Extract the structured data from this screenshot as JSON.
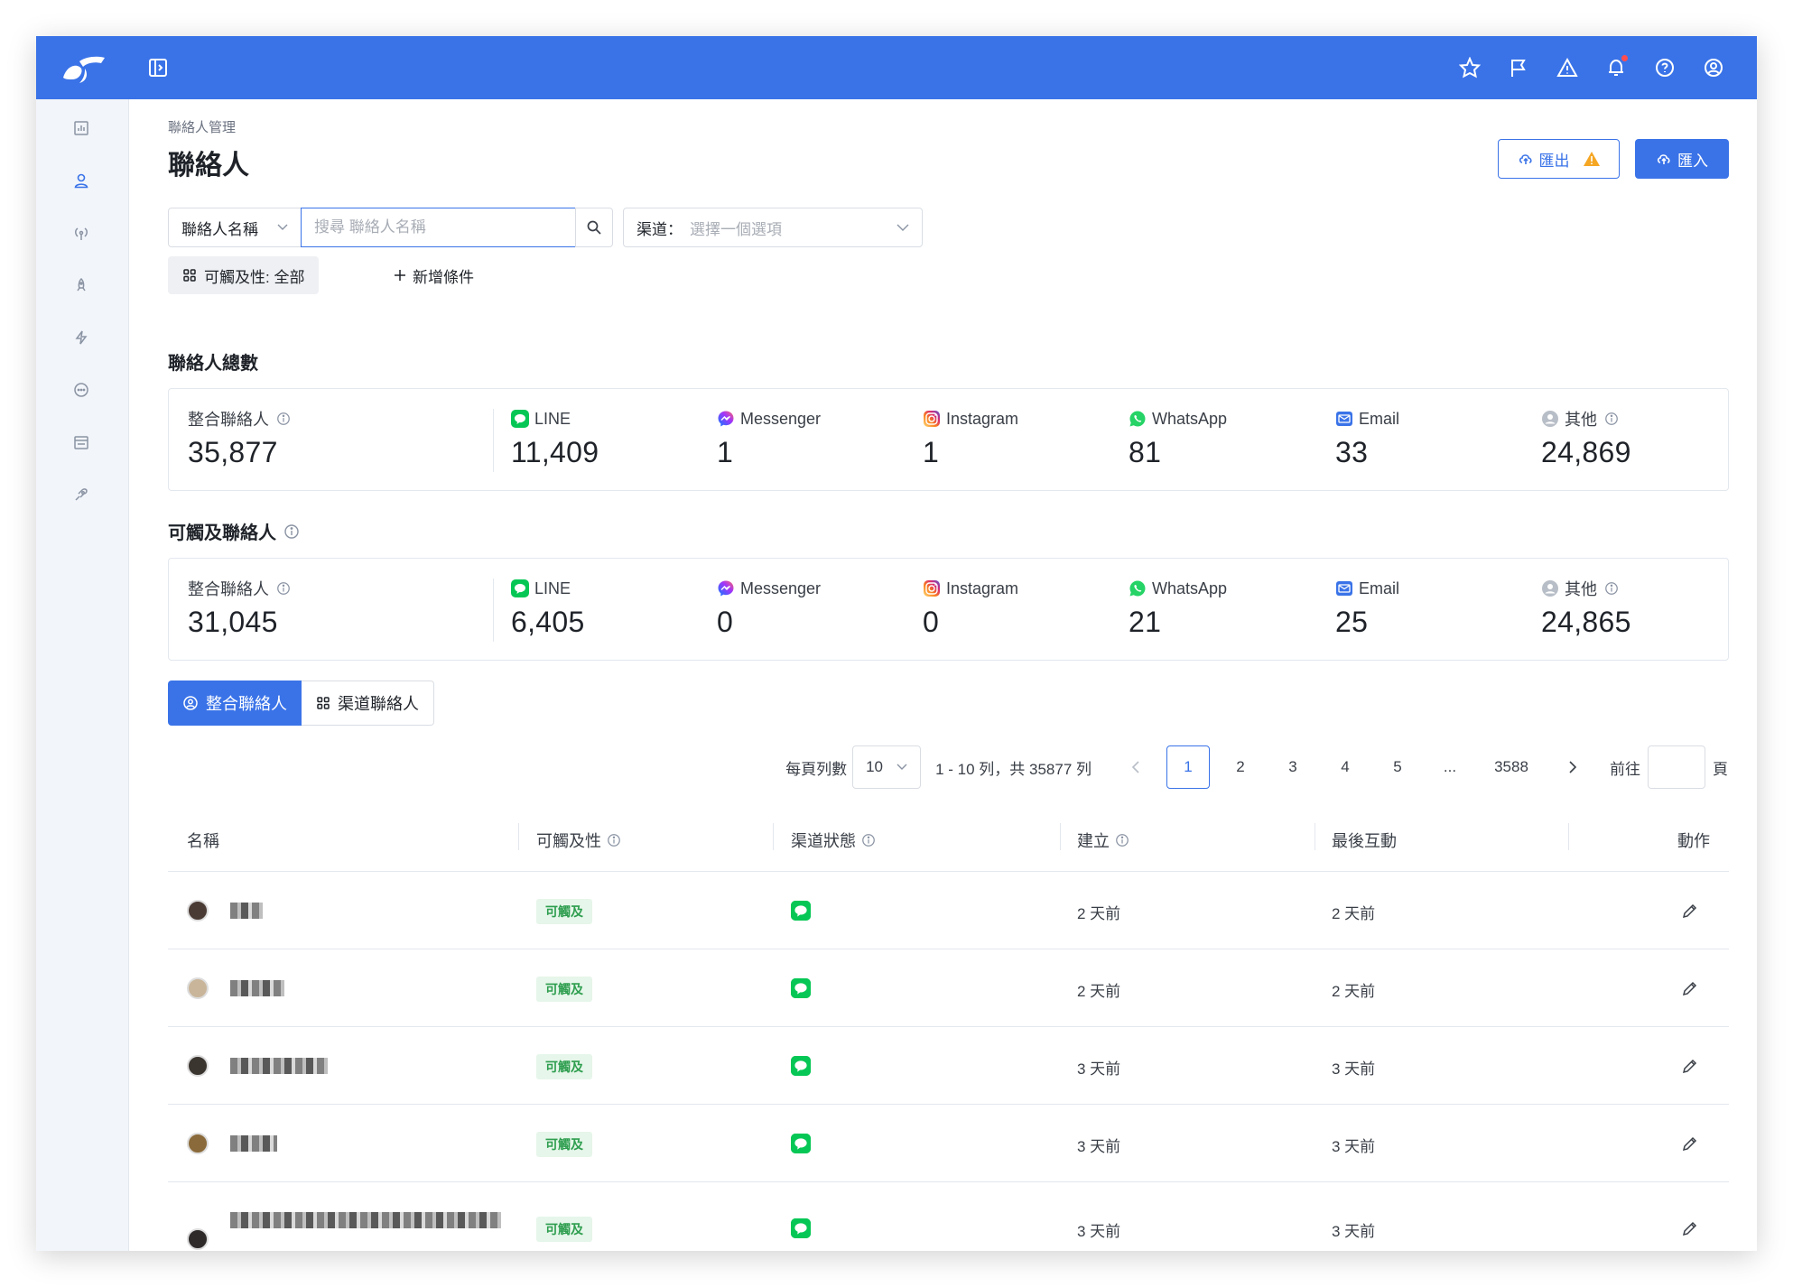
{
  "header": {
    "icons": [
      "star-icon",
      "flag-icon",
      "warning-icon",
      "bell-icon",
      "help-icon",
      "user-circle-icon"
    ]
  },
  "sidebar": {
    "items": [
      "chart-icon",
      "user-icon",
      "broadcast-icon",
      "rocket-icon",
      "lightning-icon",
      "chat-icon",
      "store-icon",
      "puzzle-icon"
    ]
  },
  "page": {
    "breadcrumb": "聯絡人管理",
    "title": "聯絡人",
    "export_label": "匯出",
    "import_label": "匯入"
  },
  "filters": {
    "field_select": "聯絡人名稱",
    "search_placeholder": "搜尋 聯絡人名稱",
    "channel_label": "渠道：",
    "channel_placeholder": "選擇一個選項",
    "reach_chip": "可觸及性: 全部",
    "add_condition": "新增條件"
  },
  "total_contacts": {
    "title": "聯絡人總數",
    "stats": [
      {
        "label": "整合聯絡人",
        "value": "35,877",
        "icon": "info"
      },
      {
        "label": "LINE",
        "value": "11,409",
        "icon": "line"
      },
      {
        "label": "Messenger",
        "value": "1",
        "icon": "messenger"
      },
      {
        "label": "Instagram",
        "value": "1",
        "icon": "instagram"
      },
      {
        "label": "WhatsApp",
        "value": "81",
        "icon": "whatsapp"
      },
      {
        "label": "Email",
        "value": "33",
        "icon": "email"
      },
      {
        "label": "其他",
        "value": "24,869",
        "icon": "other"
      }
    ]
  },
  "reachable_contacts": {
    "title": "可觸及聯絡人",
    "stats": [
      {
        "label": "整合聯絡人",
        "value": "31,045",
        "icon": "info"
      },
      {
        "label": "LINE",
        "value": "6,405",
        "icon": "line"
      },
      {
        "label": "Messenger",
        "value": "0",
        "icon": "messenger"
      },
      {
        "label": "Instagram",
        "value": "0",
        "icon": "instagram"
      },
      {
        "label": "WhatsApp",
        "value": "21",
        "icon": "whatsapp"
      },
      {
        "label": "Email",
        "value": "25",
        "icon": "email"
      },
      {
        "label": "其他",
        "value": "24,865",
        "icon": "other"
      }
    ]
  },
  "tabs": {
    "unified": "整合聯絡人",
    "channel": "渠道聯絡人"
  },
  "pagination": {
    "per_page_label": "每頁列數",
    "per_page_value": "10",
    "range_text": "1 - 10 列，共 35877 列",
    "pages": [
      "1",
      "2",
      "3",
      "4",
      "5",
      "...",
      "3588"
    ],
    "current_page": "1",
    "goto_label": "前往",
    "page_suffix": "頁"
  },
  "table": {
    "columns": {
      "name": "名稱",
      "reach": "可觸及性",
      "channel_status": "渠道狀態",
      "created": "建立",
      "last_interaction": "最後互動",
      "action": "動作"
    },
    "rows": [
      {
        "reach": "可觸及",
        "created": "2 天前",
        "last": "2 天前"
      },
      {
        "reach": "可觸及",
        "created": "2 天前",
        "last": "2 天前"
      },
      {
        "reach": "可觸及",
        "created": "3 天前",
        "last": "3 天前"
      },
      {
        "reach": "可觸及",
        "created": "3 天前",
        "last": "3 天前"
      },
      {
        "reach": "可觸及",
        "created": "3 天前",
        "last": "3 天前"
      }
    ]
  },
  "colors": {
    "primary": "#3a73e8",
    "line_green": "#06c755",
    "badge_green": "#2e9e4f",
    "warning": "#f5a623"
  }
}
